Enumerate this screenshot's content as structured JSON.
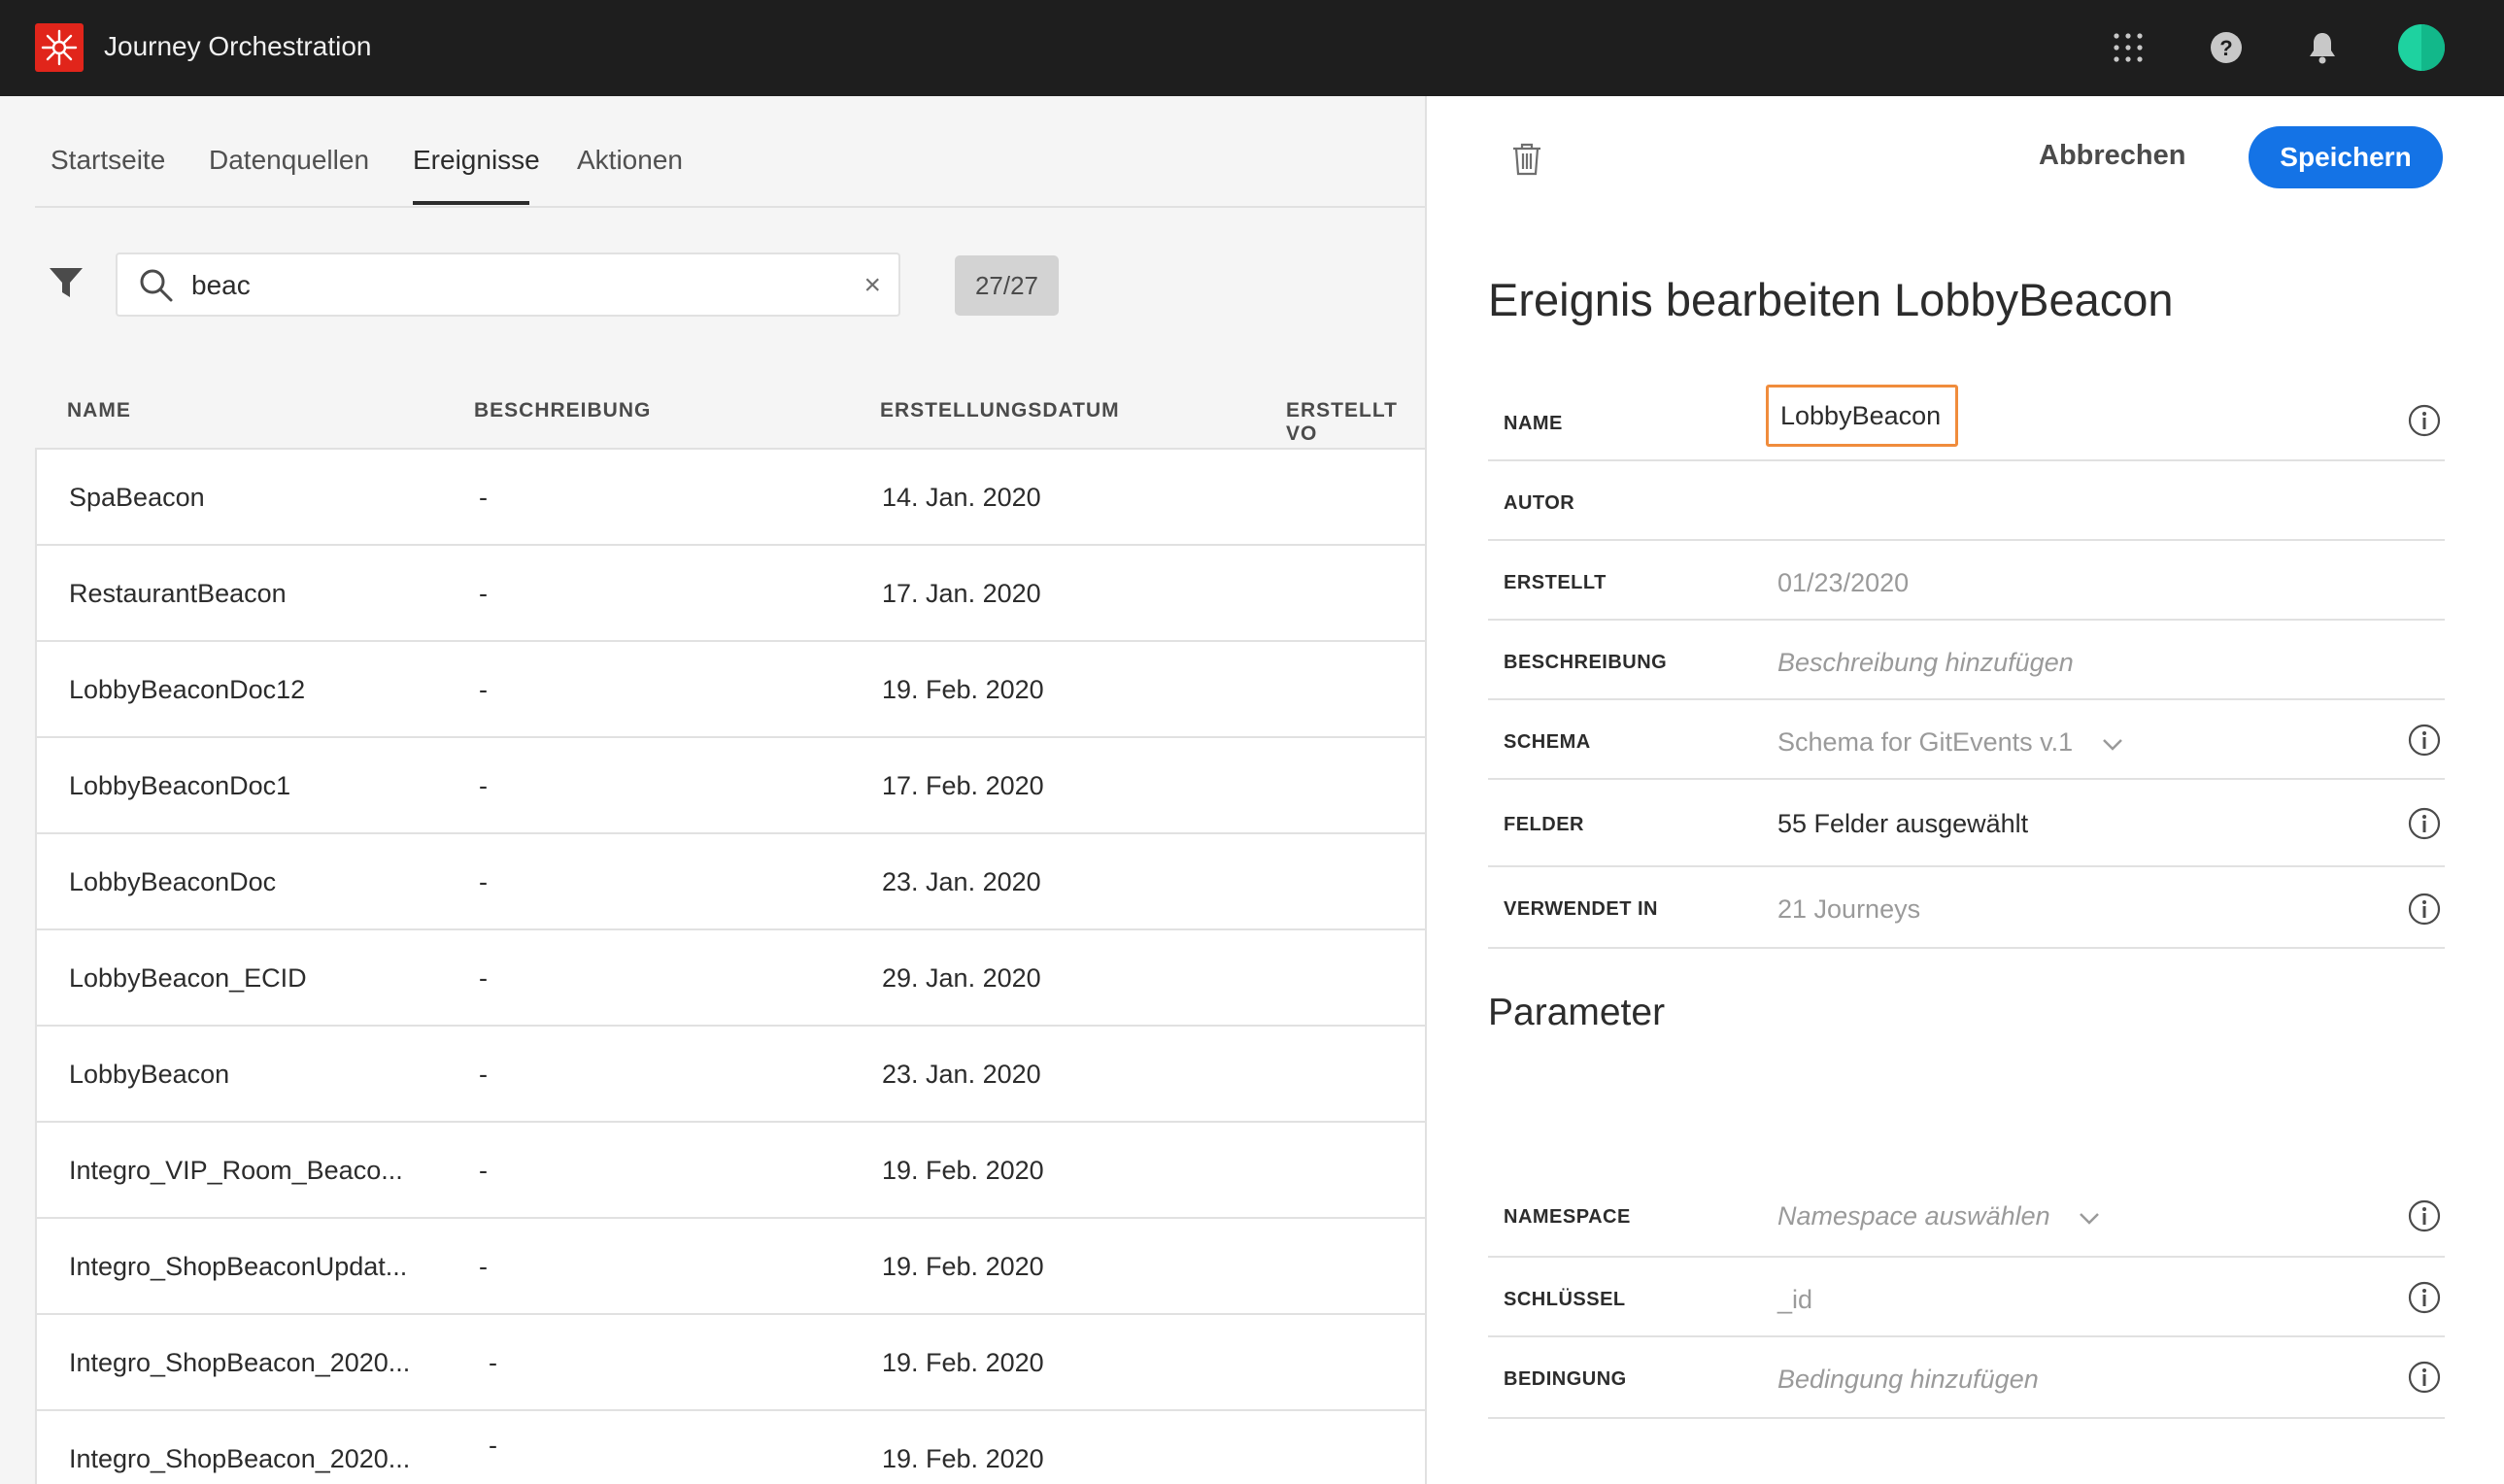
{
  "app": {
    "title": "Journey Orchestration"
  },
  "topbar_icons": [
    "apps-grid-icon",
    "help-icon",
    "bell-icon",
    "avatar"
  ],
  "tabs": [
    {
      "label": "Startseite"
    },
    {
      "label": "Datenquellen"
    },
    {
      "label": "Ereignisse",
      "active": true
    },
    {
      "label": "Aktionen"
    }
  ],
  "search": {
    "value": "beac",
    "count": "27/27"
  },
  "table": {
    "headers": [
      "NAME",
      "BESCHREIBUNG",
      "ERSTELLUNGSDATUM",
      "ERSTELLT VO"
    ],
    "rows": [
      {
        "name": "SpaBeacon",
        "desc": "-",
        "date": "14. Jan. 2020"
      },
      {
        "name": "RestaurantBeacon",
        "desc": "-",
        "date": "17. Jan. 2020"
      },
      {
        "name": "LobbyBeaconDoc12",
        "desc": "-",
        "date": "19. Feb. 2020"
      },
      {
        "name": "LobbyBeaconDoc1",
        "desc": "-",
        "date": "17. Feb. 2020"
      },
      {
        "name": "LobbyBeaconDoc",
        "desc": "-",
        "date": "23. Jan. 2020"
      },
      {
        "name": "LobbyBeacon_ECID",
        "desc": "-",
        "date": "29. Jan. 2020"
      },
      {
        "name": "LobbyBeacon",
        "desc": "-",
        "date": "23. Jan. 2020"
      },
      {
        "name": "Integro_VIP_Room_Beaco...",
        "desc": "-",
        "date": "19. Feb. 2020"
      },
      {
        "name": "Integro_ShopBeaconUpdat...",
        "desc": "-",
        "date": "19. Feb. 2020"
      },
      {
        "name": "Integro_ShopBeacon_2020...",
        "desc": "-",
        "date": "19. Feb. 2020"
      },
      {
        "name": "Integro_ShopBeacon_2020...",
        "desc": "-",
        "date": "19. Feb. 2020"
      }
    ]
  },
  "panel": {
    "delete_icon": "trash-icon",
    "cancel_label": "Abbrechen",
    "save_label": "Speichern",
    "title": "Ereignis bearbeiten LobbyBeacon",
    "fields": {
      "name_label": "NAME",
      "name_value": "LobbyBeacon",
      "author_label": "AUTOR",
      "author_value": "",
      "created_label": "ERSTELLT",
      "created_value": "01/23/2020",
      "description_label": "BESCHREIBUNG",
      "description_placeholder": "Beschreibung hinzufügen",
      "schema_label": "SCHEMA",
      "schema_value": "Schema for GitEvents v.1",
      "fields_label": "FELDER",
      "fields_value": "55 Felder ausgewählt",
      "used_in_label": "VERWENDET IN",
      "used_in_value": "21 Journeys"
    },
    "parameter_title": "Parameter",
    "params": {
      "namespace_label": "NAMESPACE",
      "namespace_placeholder": "Namespace auswählen",
      "key_label": "SCHLÜSSEL",
      "key_value": "_id",
      "condition_label": "BEDINGUNG",
      "condition_placeholder": "Bedingung hinzufügen"
    }
  },
  "colors": {
    "topbar": "#1e1e1e",
    "brand": "#e1251b",
    "primary_button": "#1473e6",
    "focus_border": "#f08c3c",
    "avatar": "#1ed2a0"
  }
}
